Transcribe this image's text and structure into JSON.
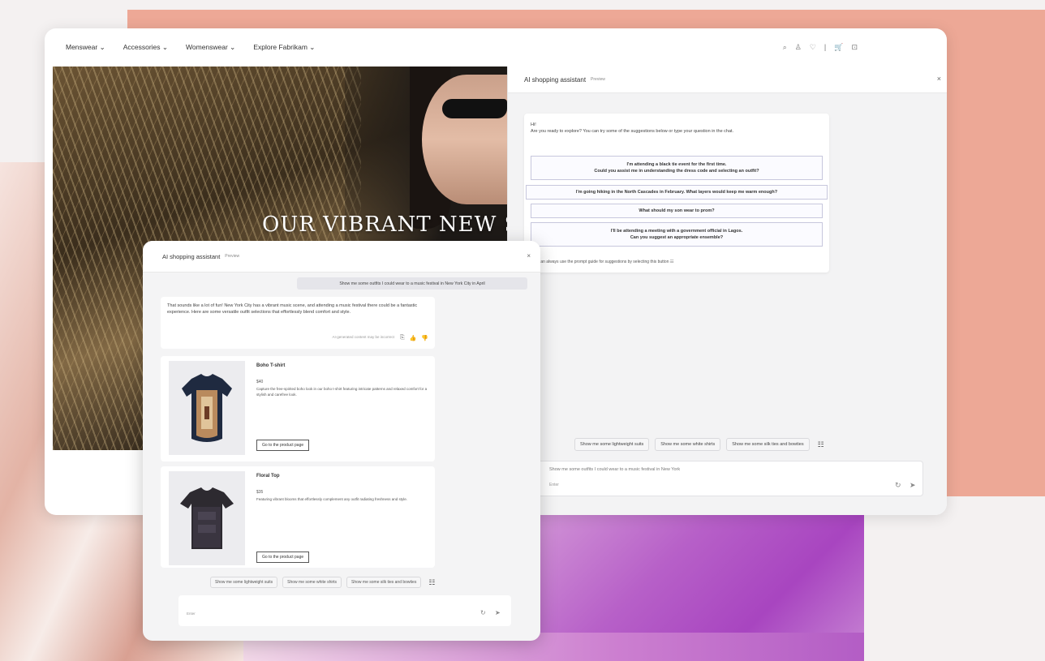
{
  "nav": {
    "items": [
      "Menswear ⌄",
      "Accessories ⌄",
      "Womenswear ⌄",
      "Explore Fabrikam ⌄"
    ],
    "icons": {
      "search": "⌕",
      "account": "♙",
      "wishlist": "♡",
      "divider": "|",
      "cart": "🛒",
      "bag": "⊡"
    }
  },
  "hero": {
    "title": "OUR VIBRANT NEW S"
  },
  "panel": {
    "title": "AI shopping assistant",
    "badge": "Preview",
    "close": "×",
    "welcome_greeting": "Hi!",
    "welcome_body": "Are you ready to explore? You can try some of the suggestions below or type your question in the chat.",
    "suggestions": [
      {
        "line1": "I'm attending a black tie event for the first time.",
        "line2": "Could you assist me in understanding the dress code and selecting an outfit?"
      },
      {
        "line1": "I'm going hiking in the North Cascades in February. What layers would keep me warm enough?",
        "line2": ""
      },
      {
        "line1": "What should my son wear to prom?",
        "line2": ""
      },
      {
        "line1": "I'll be attending a meeting with a government official in Lagos.",
        "line2": "Can you suggest an appropriate ensemble?"
      }
    ],
    "footer_note": "You can always use the prompt guide for suggestions by selecting this button",
    "chips": [
      "Show me some lightweight suits",
      "Show me some white shirts",
      "Show me some silk ties and bowties"
    ],
    "input_value": "Show me some outfits I could wear to a music festival in New York",
    "input_placeholder": "Enter",
    "icons": {
      "guide": "☷",
      "refresh": "↻",
      "send": "➤",
      "note_icon": "☷"
    }
  },
  "overlay": {
    "title": "AI shopping assistant",
    "badge": "Preview",
    "close": "×",
    "user_message": "Show me some outfits I could wear to a music festival in New York City in April",
    "bot_message": "That sounds like a lot of fun! New York City has a vibrant music scene, and attending a music festival there could be a fantastic experience. Here are some versatile outfit selections that effortlessly blend comfort and style.",
    "ai_note": "AI-generated content may be incorrect",
    "reactions": {
      "copy": "⎘",
      "like": "👍",
      "dislike": "👎"
    },
    "products": [
      {
        "title": "Boho T-shirt",
        "price": "$40",
        "desc": "Capture the free-spirited boho look in our boho t-shirt featuring intricate patterns and relaxed comfort for a stylish and carefree look.",
        "button": "Go to the product page"
      },
      {
        "title": "Floral Top",
        "price": "$35",
        "desc": "Featuring vibrant blooms that effortlessly complement any outfit radiating freshness and style.",
        "button": "Go to the product page"
      }
    ],
    "chips": [
      "Show me some lightweight suits",
      "Show me some white shirts",
      "Show me some silk ties and bowties"
    ],
    "input_placeholder": "Enter",
    "icons": {
      "guide": "☷",
      "refresh": "↻",
      "send": "➤"
    }
  }
}
